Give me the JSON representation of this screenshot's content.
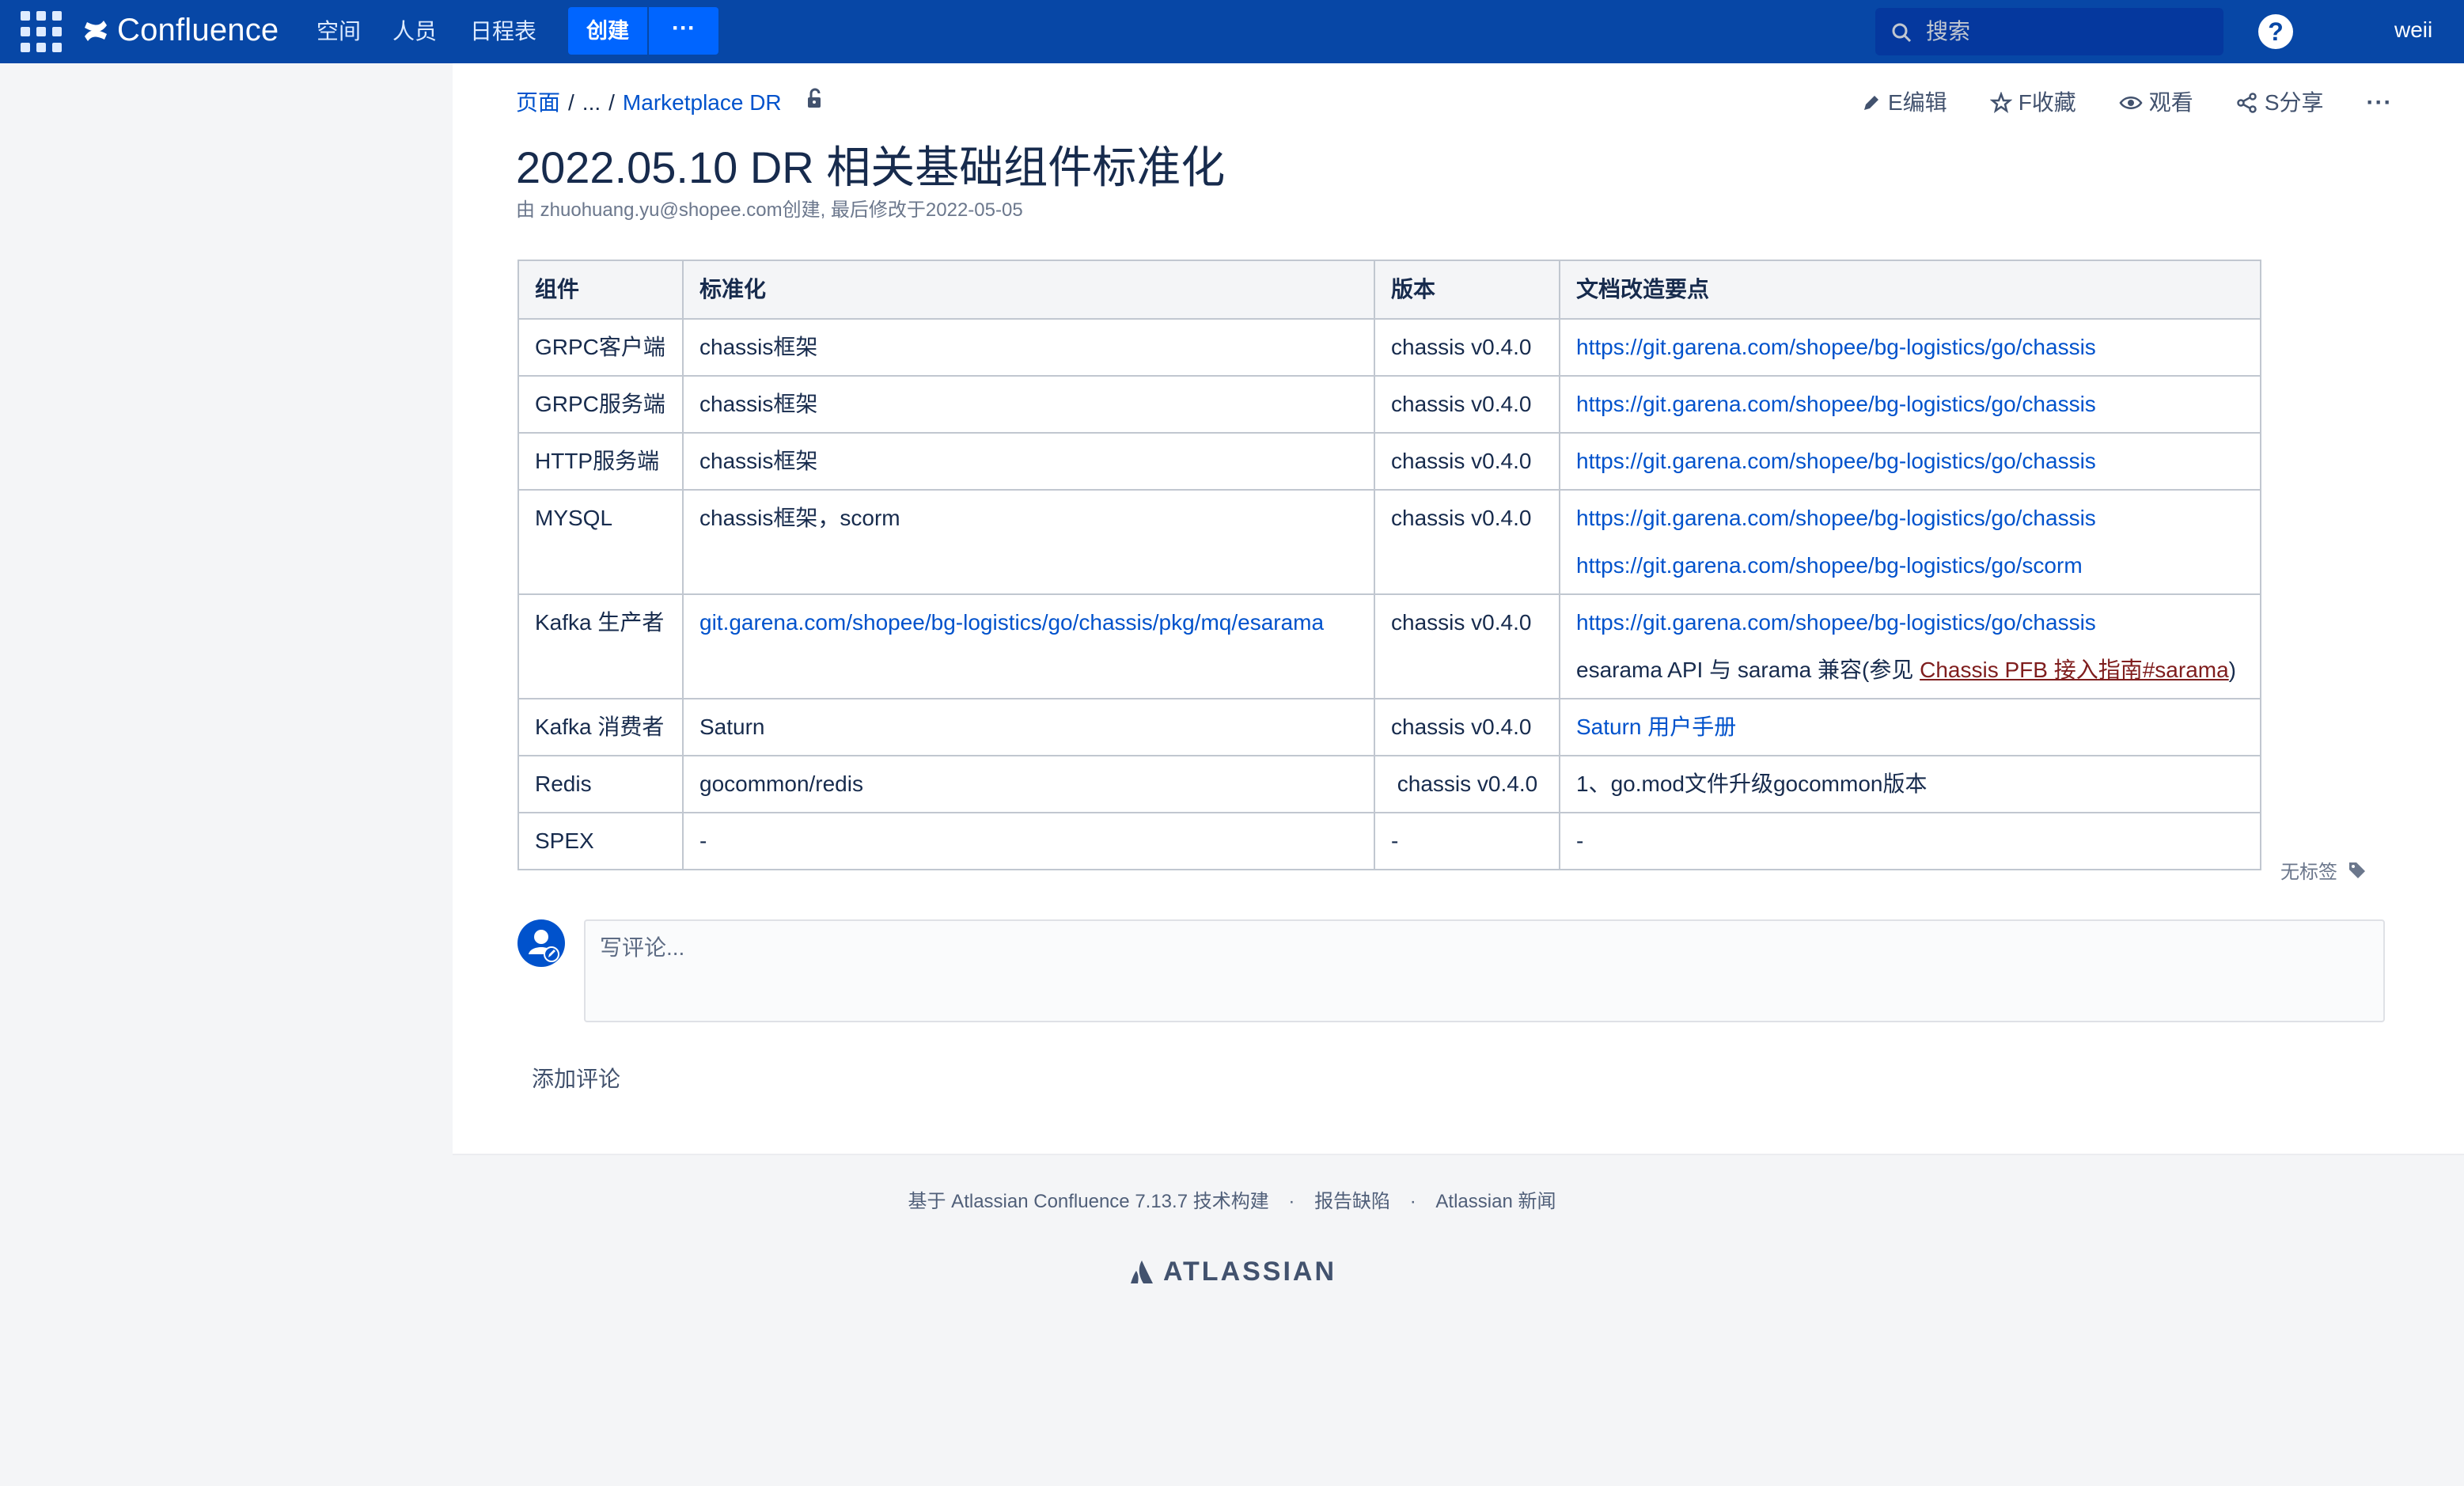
{
  "header": {
    "app_name": "Confluence",
    "nav": [
      "空间",
      "人员",
      "日程表"
    ],
    "create_label": "创建",
    "more_label": "···",
    "search_placeholder": "搜索",
    "help_label": "?",
    "user_name": "weii"
  },
  "breadcrumb": {
    "root": "页面",
    "ellipsis": "...",
    "parent": "Marketplace DR"
  },
  "page_actions": {
    "edit": "E编辑",
    "favorite": "F收藏",
    "watch": "观看",
    "share": "S分享",
    "more": "···"
  },
  "page": {
    "title": "2022.05.10 DR 相关基础组件标准化",
    "byline": "由 zhuohuang.yu@shopee.com创建, 最后修改于2022-05-05"
  },
  "table": {
    "headers": [
      "组件",
      "标准化",
      "版本",
      "文档改造要点"
    ],
    "rows": [
      {
        "component": "GRPC客户端",
        "standard": "chassis框架",
        "version": "chassis v0.4.0",
        "doc": "https://git.garena.com/shopee/bg-logistics/go/chassis"
      },
      {
        "component": "GRPC服务端",
        "standard": "chassis框架",
        "version": "chassis v0.4.0",
        "doc": "https://git.garena.com/shopee/bg-logistics/go/chassis"
      },
      {
        "component": "HTTP服务端",
        "standard": "chassis框架",
        "version": "chassis v0.4.0",
        "doc": "https://git.garena.com/shopee/bg-logistics/go/chassis"
      },
      {
        "component": "MYSQL",
        "standard": "chassis框架，scorm",
        "version": "chassis v0.4.0",
        "doc": "https://git.garena.com/shopee/bg-logistics/go/chassis",
        "doc2": "https://git.garena.com/shopee/bg-logistics/go/scorm"
      },
      {
        "component": "Kafka 生产者",
        "standard": "git.garena.com/shopee/bg-logistics/go/chassis/pkg/mq/esarama",
        "version": "chassis v0.4.0",
        "doc": "https://git.garena.com/shopee/bg-logistics/go/chassis",
        "doc2_prefix": "esarama API 与 sarama 兼容(参见 ",
        "doc2_link": "Chassis PFB 接入指南#sarama",
        "doc2_suffix": ")"
      },
      {
        "component": "Kafka 消费者",
        "standard": "Saturn",
        "version": "chassis v0.4.0",
        "doc": "Saturn 用户手册"
      },
      {
        "component": "Redis",
        "standard": "gocommon/redis",
        "version": " chassis v0.4.0",
        "doc": "1、go.mod文件升级gocommon版本"
      },
      {
        "component": "SPEX",
        "standard": "-",
        "version": "-",
        "doc": "-"
      }
    ]
  },
  "labels": {
    "text": "无标签"
  },
  "comments": {
    "placeholder": "写评论...",
    "add_label": "添加评论"
  },
  "footer": {
    "built_with": "基于 Atlassian Confluence 7.13.7 技术构建",
    "report": "报告缺陷",
    "news": "Atlassian 新闻",
    "brand": "ATLASSIAN"
  },
  "colors": {
    "topbar": "#0747a6",
    "button": "#0065ff",
    "link": "#0052cc",
    "text": "#172b4d"
  }
}
